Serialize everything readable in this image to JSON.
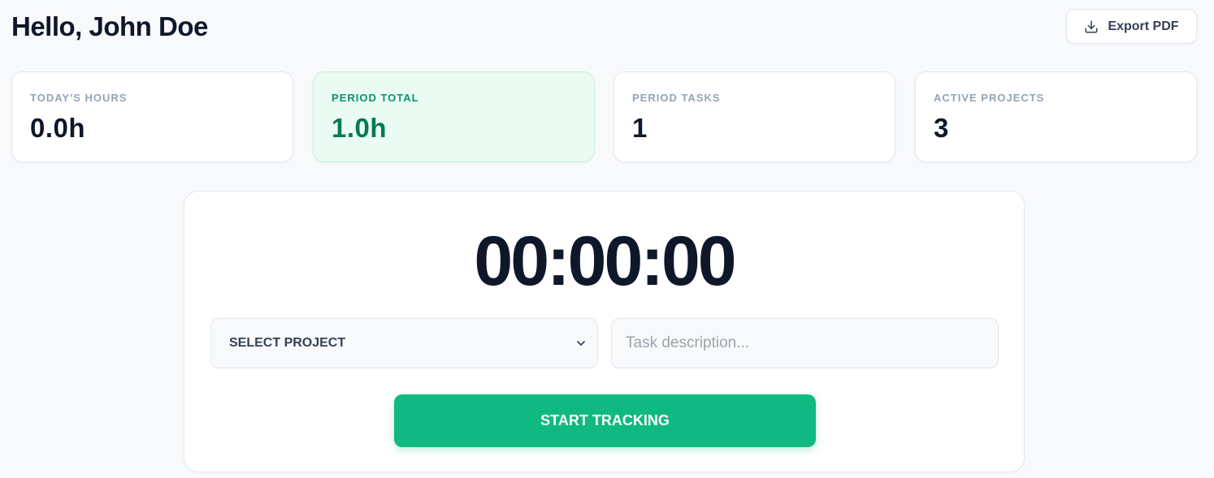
{
  "header": {
    "greeting": "Hello, John Doe",
    "export_label": "Export PDF",
    "export_icon": "download-icon"
  },
  "stats": [
    {
      "label": "TODAY'S HOURS",
      "value": "0.0h"
    },
    {
      "label": "PERIOD TOTAL",
      "value": "1.0h",
      "highlight": true
    },
    {
      "label": "PERIOD TASKS",
      "value": "1"
    },
    {
      "label": "ACTIVE PROJECTS",
      "value": "3"
    }
  ],
  "timer": {
    "display": "00:00:00",
    "project_select": {
      "selected": "SELECT PROJECT",
      "icon": "chevron-down-icon"
    },
    "task_input": {
      "value": "",
      "placeholder": "Task description..."
    },
    "start_label": "START TRACKING"
  },
  "colors": {
    "accent": "#10b981",
    "highlight_bg": "#e9fbf2",
    "highlight_text": "#047857",
    "text_dark": "#0f172a",
    "label_muted": "#94a3b8"
  }
}
